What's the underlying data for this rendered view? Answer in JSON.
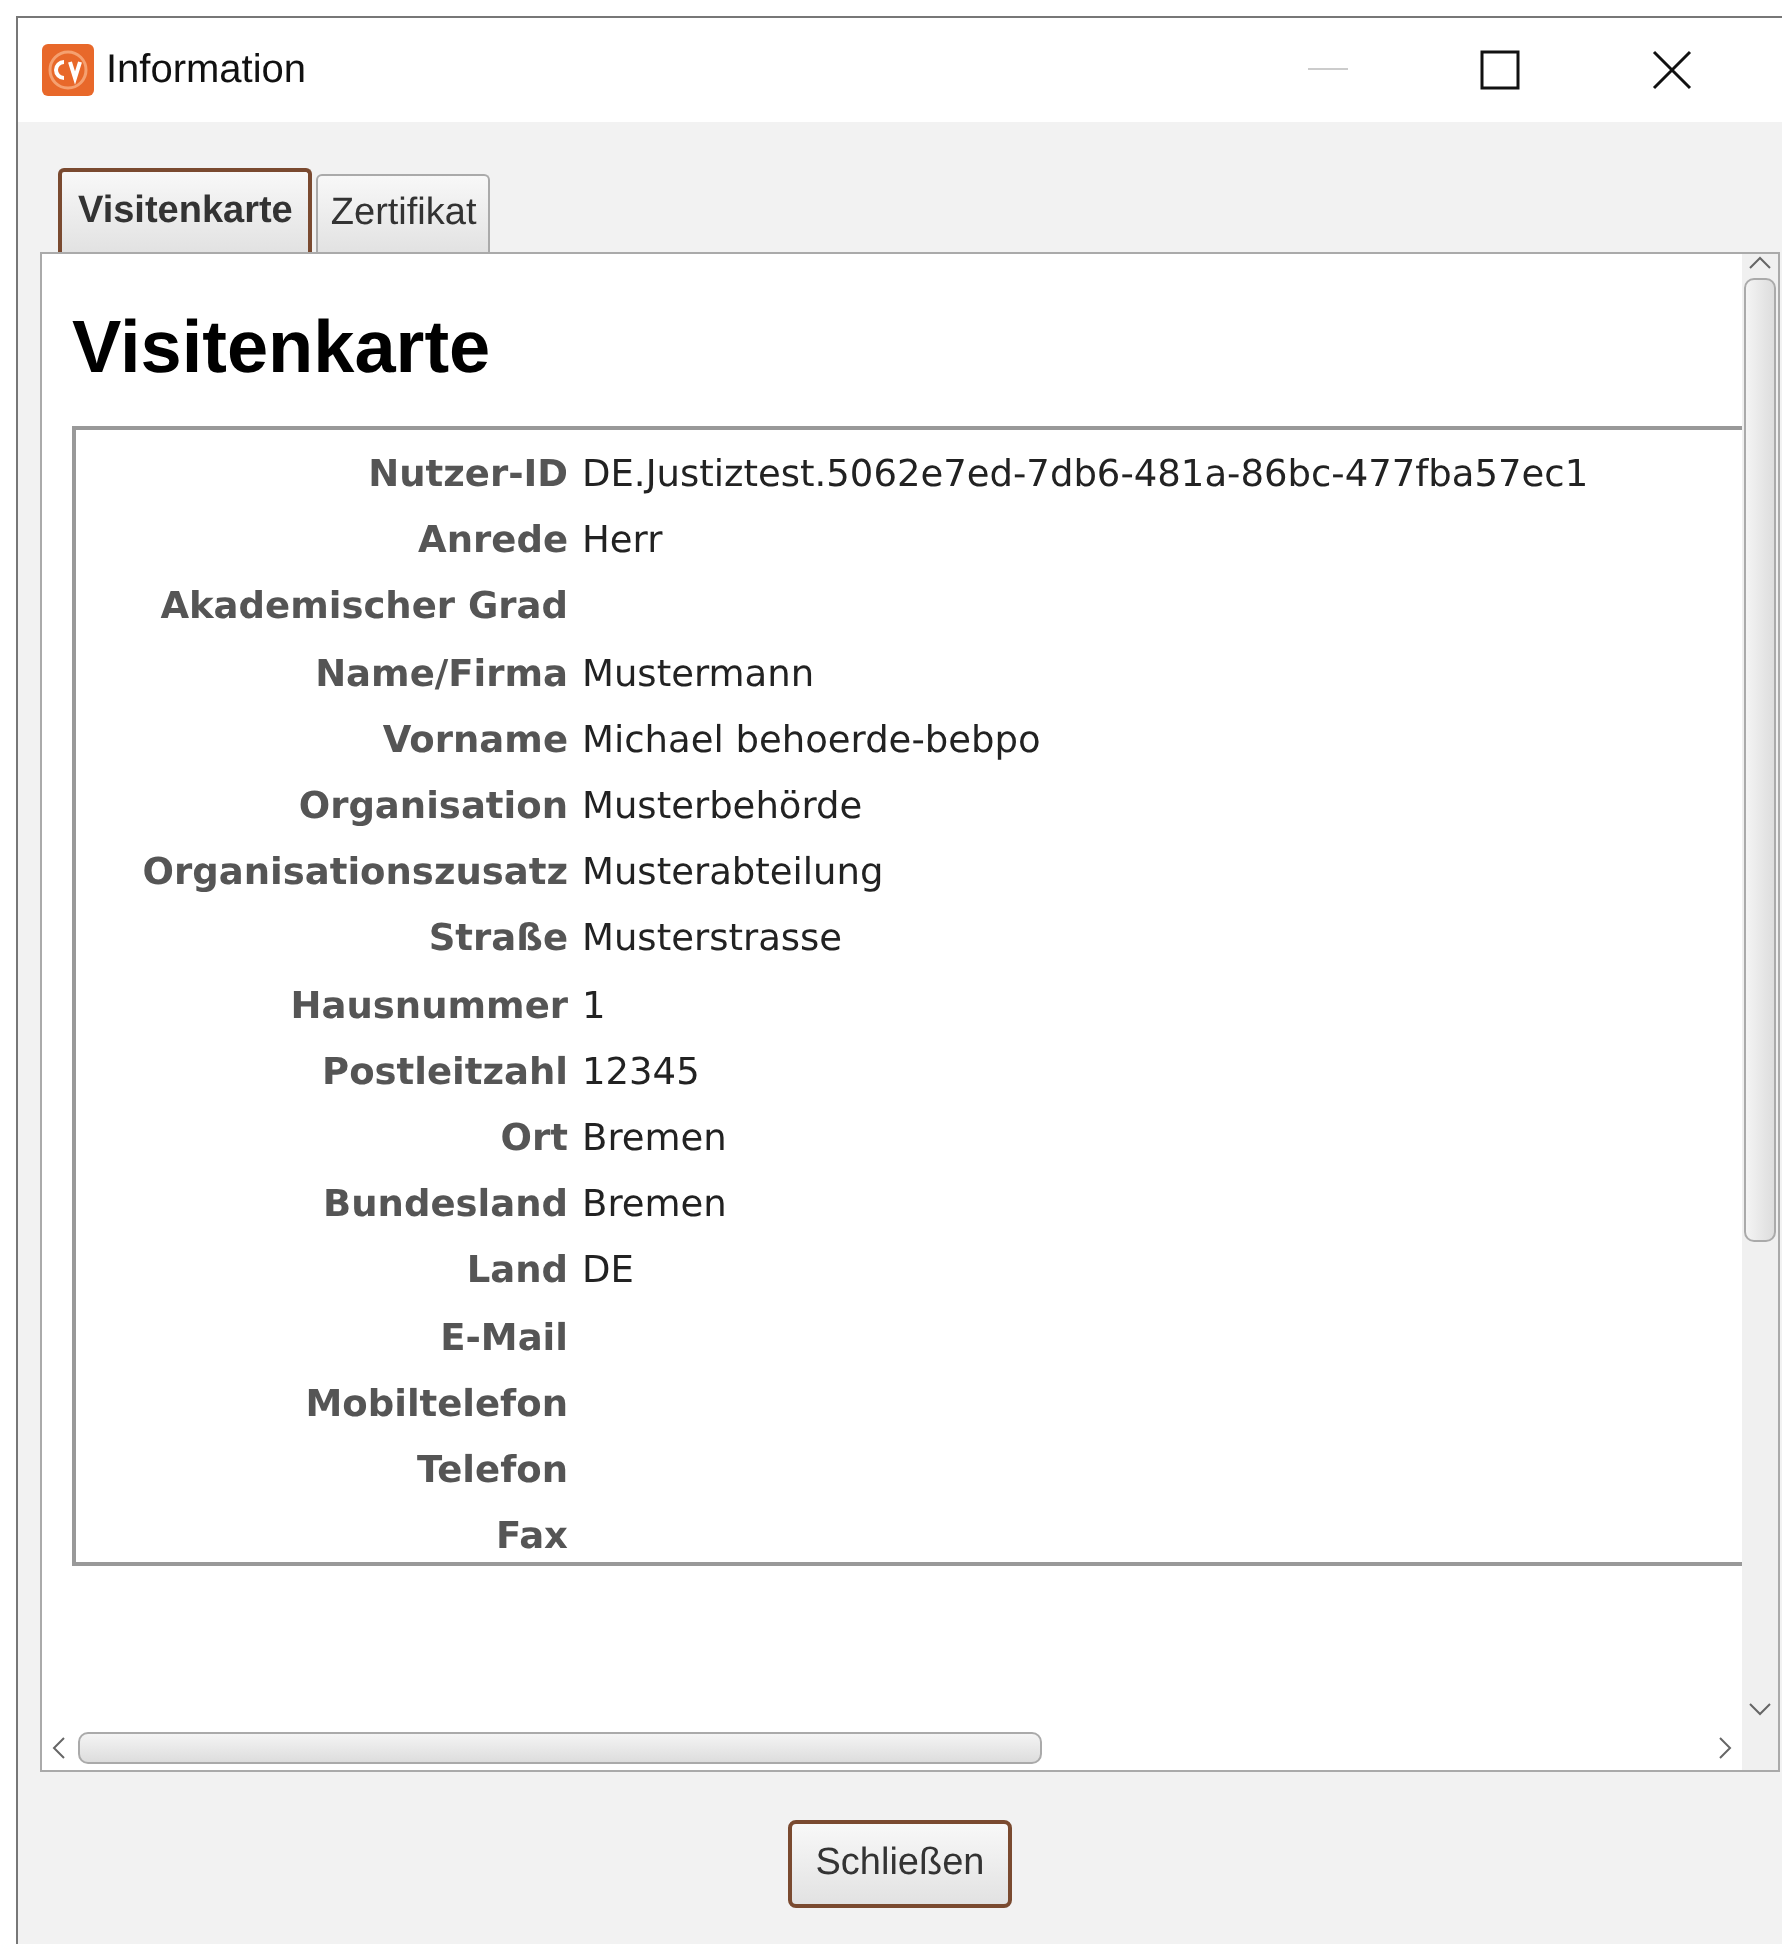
{
  "window": {
    "title": "Information"
  },
  "tabs": [
    {
      "label": "Visitenkarte",
      "selected": true
    },
    {
      "label": "Zertifikat",
      "selected": false
    }
  ],
  "heading": "Visitenkarte",
  "fields": [
    {
      "label": "Nutzer-ID",
      "value": "DE.Justiztest.5062e7ed-7db6-481a-86bc-477fba57ec1"
    },
    {
      "label": "Anrede",
      "value": "Herr"
    },
    {
      "label": "Akademischer Grad"
    },
    {
      "label": "Name/Firma",
      "value": "Mustermann"
    },
    {
      "label": "Vorname",
      "value": "Michael behoerde-bebpo"
    },
    {
      "label": "Organisation",
      "value": "Musterbehörde"
    },
    {
      "label": "Organisationszusatz",
      "value": "Musterabteilung"
    },
    {
      "label": "Straße",
      "value": "Musterstrasse"
    },
    {
      "label": "Hausnummer",
      "value": "1"
    },
    {
      "label": "Postleitzahl",
      "value": "12345"
    },
    {
      "label": "Ort",
      "value": "Bremen"
    },
    {
      "label": "Bundesland",
      "value": "Bremen"
    },
    {
      "label": "Land",
      "value": "DE"
    },
    {
      "label": "E-Mail"
    },
    {
      "label": "Mobiltelefon"
    },
    {
      "label": "Telefon"
    },
    {
      "label": "Fax"
    }
  ],
  "buttons": [
    "Schließen"
  ]
}
